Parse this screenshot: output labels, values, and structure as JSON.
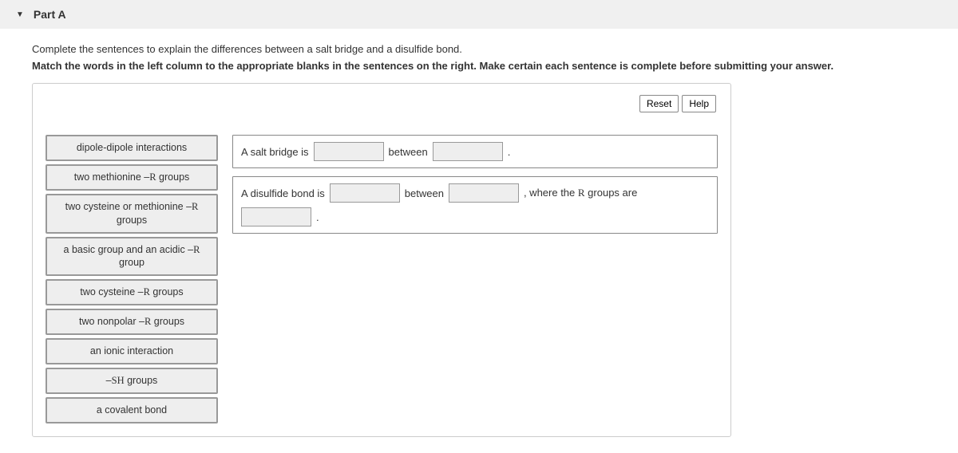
{
  "header": {
    "title": "Part A"
  },
  "instructions": {
    "line1": "Complete the sentences to explain the differences between a salt bridge and a disulfide bond.",
    "line2": "Match the words in the left column to the appropriate blanks in the sentences on the right. Make certain each sentence is complete before submitting your answer."
  },
  "buttons": {
    "reset": "Reset",
    "help": "Help"
  },
  "wordbank": {
    "items": [
      "dipole-dipole interactions",
      "two methionine –R groups",
      "two cysteine or methionine –R groups",
      "a basic group and an acidic –R group",
      "two cysteine –R groups",
      "two nonpolar –R groups",
      "an ionic interaction",
      "–SH groups",
      "a covalent bond"
    ]
  },
  "sentences": {
    "s1": {
      "t1": "A salt bridge is",
      "t2": "between",
      "t3": "."
    },
    "s2": {
      "t1": "A disulfide bond is",
      "t2": "between",
      "t3": ", where the R groups are",
      "t4": "."
    }
  }
}
